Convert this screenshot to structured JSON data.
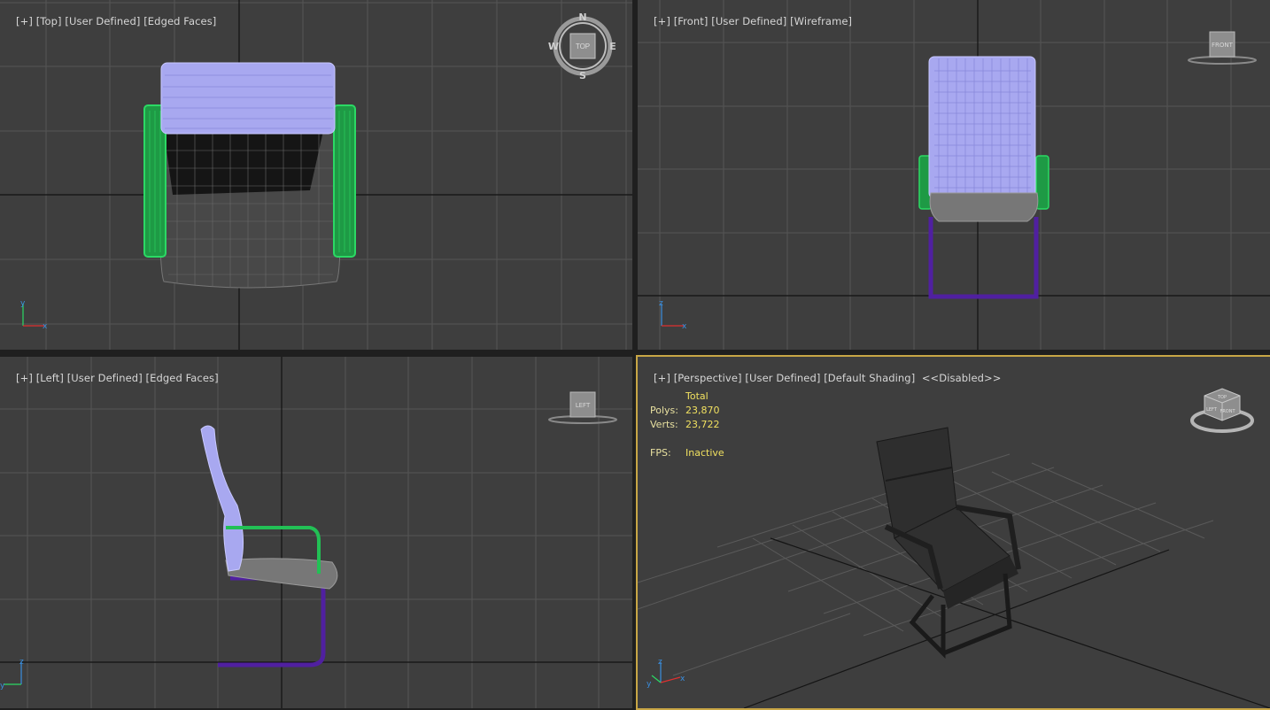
{
  "viewports": {
    "top": {
      "label_parts": [
        "[+]",
        "[Top]",
        "[User Defined]",
        "[Edged Faces]"
      ],
      "cube_label": "TOP",
      "compass": {
        "n": "N",
        "s": "S",
        "e": "E",
        "w": "W"
      },
      "axis": {
        "x": "x",
        "y": "y"
      }
    },
    "front": {
      "label_parts": [
        "[+]",
        "[Front]",
        "[User Defined]",
        "[Wireframe]"
      ],
      "cube_label": "FRONT",
      "axis": {
        "x": "x",
        "y": "z"
      }
    },
    "left": {
      "label_parts": [
        "[+]",
        "[Left]",
        "[User Defined]",
        "[Edged Faces]"
      ],
      "cube_label": "LEFT",
      "axis": {
        "x": "y",
        "y": "z"
      }
    },
    "perspective": {
      "label_parts": [
        "[+]",
        "[Perspective]",
        "[User Defined]",
        "[Default Shading]",
        "<<Disabled>>"
      ],
      "stats": {
        "header": "Total",
        "polys_label": "Polys:",
        "polys": "23,870",
        "verts_label": "Verts:",
        "verts": "23,722",
        "fps_label": "FPS:",
        "fps": "Inactive"
      },
      "cube_labels": {
        "top": "TOP",
        "front": "FRONT",
        "left": "LEFT"
      },
      "axis": {
        "x": "x",
        "y": "z",
        "z": "y"
      }
    }
  },
  "colors": {
    "viewport_bg": "#3e3e3e",
    "grid": "#5a5a5a",
    "grid_axis": "#141414",
    "backrest": "#a8a8f0",
    "armrest": "#22c055",
    "frame": "#5020a0",
    "seat": "#8a8a8a",
    "active_border": "#c8a646",
    "stats_text": "#f0e060"
  }
}
